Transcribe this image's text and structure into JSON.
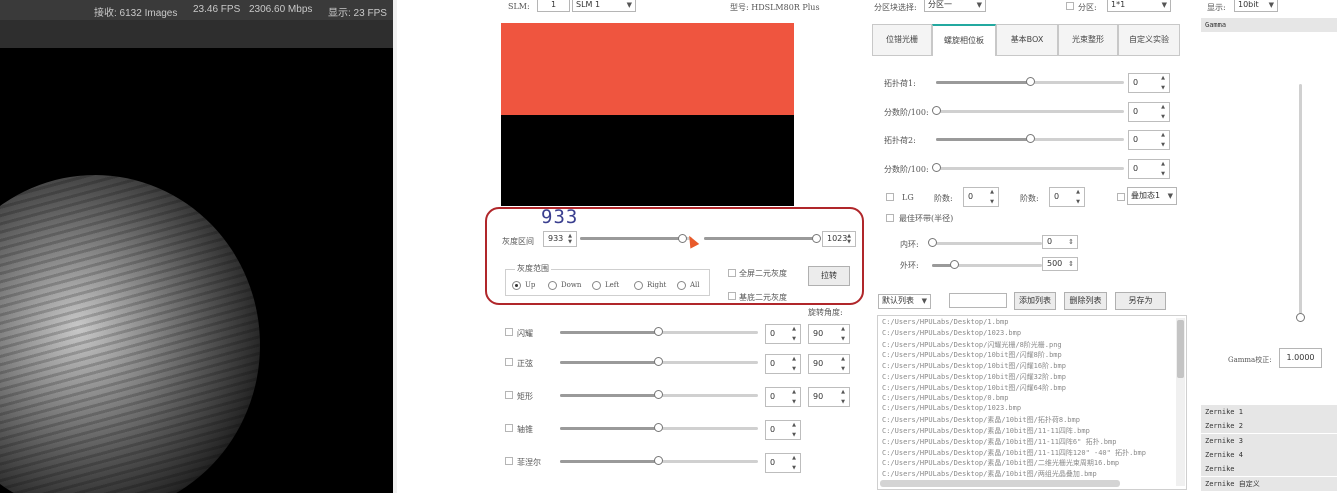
{
  "camera": {
    "status": {
      "received": "接收: 6132 Images",
      "fps": "23.46 FPS",
      "bandwidth": "2306.60 Mbps",
      "display": "显示: 23 FPS"
    }
  },
  "top_bar": {
    "slm_label": "SLM:",
    "slm_index": "1",
    "slm_select": "SLM 1",
    "model_label": "型号: HDSLM80R Plus",
    "partition_select_label": "分区块选择:",
    "partition_select_value": "分区一",
    "partition_check_label": "分区:",
    "partition_value": "1*1",
    "display_label": "显示:",
    "display_value": "10bit"
  },
  "preview": {
    "top_color": "#ef553f",
    "bottom_color": "#000000",
    "split_fraction": 0.5
  },
  "gray_level": {
    "label": "灰度区间",
    "overlay_value": "933",
    "low_value": "933",
    "high_value": "1023",
    "low_fraction": 0.912,
    "high_fraction": 1.0,
    "range_group_label": "灰度范围",
    "range_options": [
      "Up",
      "Down",
      "Left",
      "Right",
      "All"
    ],
    "range_selected": "Up",
    "full_binary_label": "全屏二元灰度",
    "odd_binary_label": "基底二元灰度",
    "invert_button": "拉转"
  },
  "rotation_angle_label": "旋转角度:",
  "aberrations": [
    {
      "label": "闪耀",
      "value": "0",
      "angle": "90"
    },
    {
      "label": "正弦",
      "value": "0",
      "angle": "90"
    },
    {
      "label": "矩形",
      "value": "0",
      "angle": "90"
    },
    {
      "label": "轴锥",
      "value": "0"
    },
    {
      "label": "菲涅尔",
      "value": "0"
    }
  ],
  "tabs": [
    "位错光栅",
    "螺旋相位板",
    "基本BOX",
    "光束整形",
    "自定义实验"
  ],
  "active_tab": "螺旋相位板",
  "vortex": {
    "rows": [
      {
        "label": "拓扑荷1:",
        "value": "0",
        "fraction": 0.5
      },
      {
        "label": "分数阶/100:",
        "value": "0",
        "fraction": 0.0
      },
      {
        "label": "拓扑荷2:",
        "value": "0",
        "fraction": 0.5
      },
      {
        "label": "分数阶/100:",
        "value": "0",
        "fraction": 0.0
      }
    ],
    "lg_label": "LG",
    "p_label": "阶数:",
    "p_value": "0",
    "l_label": "阶数:",
    "l_value": "0",
    "overlay_label": "叠加态1",
    "best_ring_label": "最佳环带(半径)",
    "inner_label": "内环:",
    "inner_value": "0",
    "inner_fraction": 0.0,
    "outer_label": "外环:",
    "outer_value": "500",
    "outer_fraction": 0.2
  },
  "list_controls": {
    "default_list": "默认列表",
    "add_button": "添加列表",
    "delete_button": "删除列表",
    "save_button": "另存为"
  },
  "file_list": [
    "C:/Users/HPULabs/Desktop/1.bmp",
    "C:/Users/HPULabs/Desktop/1023.bmp",
    "C:/Users/HPULabs/Desktop/闪耀光栅/8阶光栅.png",
    "C:/Users/HPULabs/Desktop/10bit图/闪耀8阶.bmp",
    "C:/Users/HPULabs/Desktop/10bit图/闪耀16阶.bmp",
    "C:/Users/HPULabs/Desktop/10bit图/闪耀32阶.bmp",
    "C:/Users/HPULabs/Desktop/10bit图/闪耀64阶.bmp",
    "C:/Users/HPULabs/Desktop/0.bmp",
    "C:/Users/HPULabs/Desktop/1023.bmp",
    "C:/Users/HPULabs/Desktop/素晶/10bit图/拓扑荷8.bmp",
    "C:/Users/HPULabs/Desktop/素晶/10bit图/11-11四阵.bmp",
    "C:/Users/HPULabs/Desktop/素晶/10bit图/11-11四阵6\" 拓扑.bmp",
    "C:/Users/HPULabs/Desktop/素晶/10bit图/11-11四阵120\" -40\" 拓扑.bmp",
    "C:/Users/HPULabs/Desktop/素晶/10bit图/二维光栅光束周期16.bmp",
    "C:/Users/HPULabs/Desktop/素晶/10bit图/两组光晶叠加.bmp"
  ],
  "gamma": {
    "header": "Gamma",
    "correction_label": "Gamma校正:",
    "correction_value": "1.0000"
  },
  "zernike": [
    "Zernike 1",
    "Zernike 2",
    "Zernike 3",
    "Zernike 4",
    "Zernike",
    "Zernike 自定义"
  ]
}
